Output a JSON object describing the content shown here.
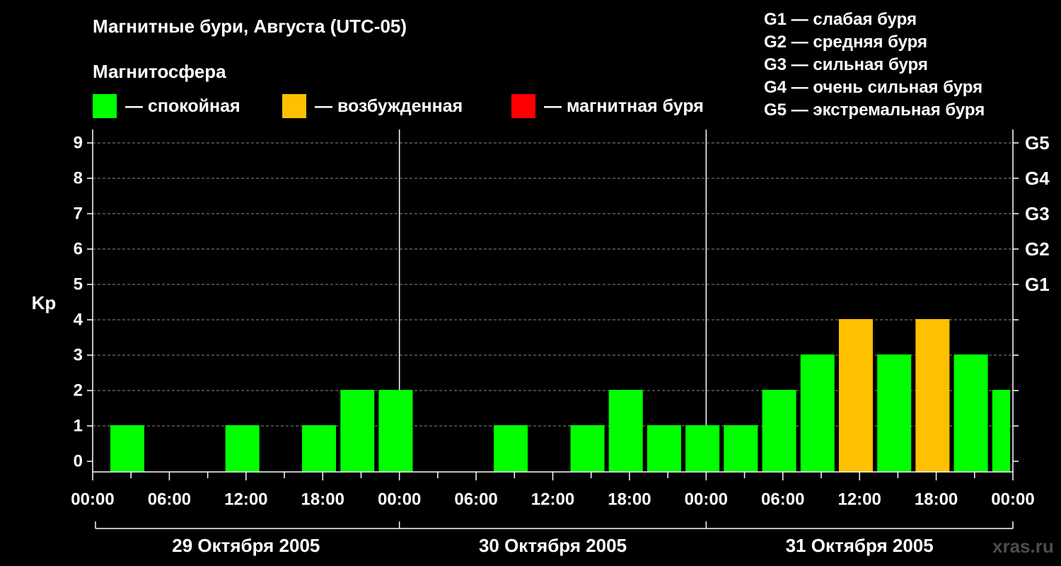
{
  "header": {
    "title": "Магнитные бури, Августа (UTC-05)",
    "magnetosphere_label": "Магнитосфера"
  },
  "legend": [
    {
      "color": "#00ff00",
      "label": "— спокойная"
    },
    {
      "color": "#ffc000",
      "label": "— возбужденная"
    },
    {
      "color": "#ff0000",
      "label": "— магнитная буря"
    }
  ],
  "g_levels": [
    "G1 — слабая буря",
    "G2 — средняя буря",
    "G3 — сильная буря",
    "G4 — очень сильная буря",
    "G5 — экстремальная буря"
  ],
  "watermark": "xras.ru",
  "chart_data": {
    "type": "bar",
    "ylabel": "Kp",
    "ylim": [
      0,
      9
    ],
    "y_ticks": [
      0,
      1,
      2,
      3,
      4,
      5,
      6,
      7,
      8,
      9
    ],
    "right_ticks": [
      {
        "y": 5,
        "label": "G1"
      },
      {
        "y": 6,
        "label": "G2"
      },
      {
        "y": 7,
        "label": "G3"
      },
      {
        "y": 8,
        "label": "G4"
      },
      {
        "y": 9,
        "label": "G5"
      }
    ],
    "x_tick_labels": [
      "00:00",
      "06:00",
      "12:00",
      "18:00",
      "00:00",
      "06:00",
      "12:00",
      "18:00",
      "00:00",
      "06:00",
      "12:00",
      "18:00",
      "00:00"
    ],
    "days": [
      "29 Октября 2005",
      "30 Октября 2005",
      "31 Октября 2005"
    ],
    "interval_hours": 3,
    "values": [
      1,
      0,
      0,
      1,
      0,
      1,
      2,
      2,
      0,
      0,
      1,
      0,
      1,
      2,
      1,
      1,
      1,
      2,
      3,
      4,
      3,
      4,
      3,
      2
    ],
    "colors": {
      "quiet": "#00ff00",
      "active": "#ffc000",
      "storm": "#ff0000"
    },
    "grid": "dashed horizontal"
  }
}
